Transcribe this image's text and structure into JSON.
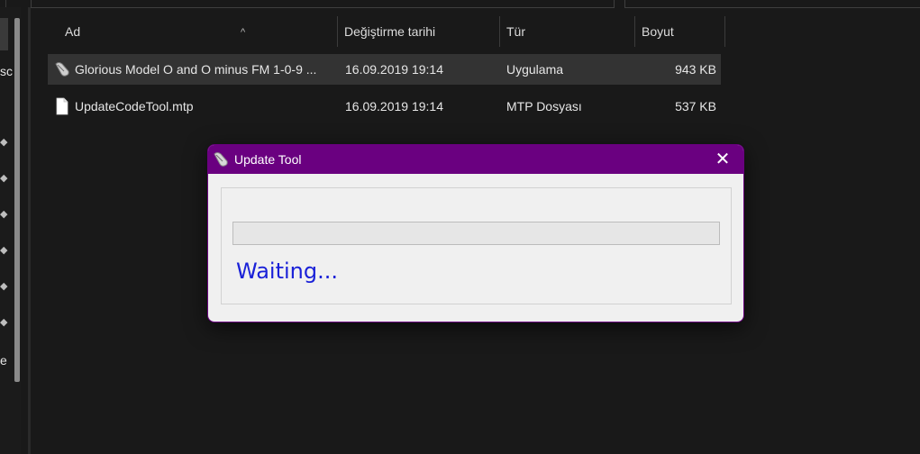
{
  "nav_pane": {
    "partial_label_1": "sc",
    "partial_label_2": "e"
  },
  "columns": {
    "name": "Ad",
    "date": "Değiştirme tarihi",
    "type": "Tür",
    "size": "Boyut",
    "sort_indicator": "^"
  },
  "files": [
    {
      "name": "Glorious Model O and O minus FM 1-0-9 ...",
      "date": "16.09.2019 19:14",
      "type": "Uygulama",
      "size": "943 KB",
      "icon": "mouse-app-icon",
      "selected": true
    },
    {
      "name": "UpdateCodeTool.mtp",
      "date": "16.09.2019 19:14",
      "type": "MTP Dosyası",
      "size": "537 KB",
      "icon": "document-icon",
      "selected": false
    }
  ],
  "dialog": {
    "title": "Update Tool",
    "close_glyph": "✕",
    "status": "Waiting...",
    "progress": 0
  },
  "colors": {
    "accent": "#6a0080",
    "status_text": "#1a21d8",
    "background": "#191919"
  }
}
